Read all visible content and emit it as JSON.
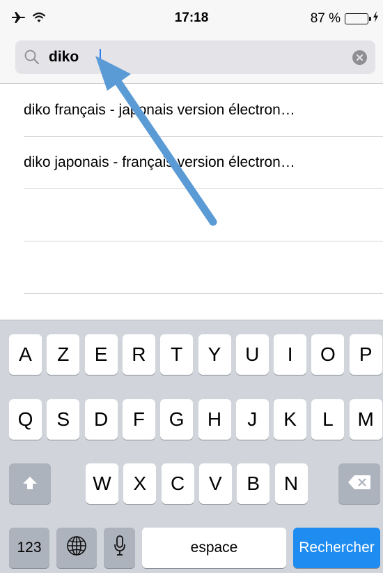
{
  "status": {
    "time": "17:18",
    "battery_text": "87 %",
    "battery_level": 0.87,
    "icons": [
      "airplane-icon",
      "wifi-icon",
      "battery-icon",
      "charging-bolt-icon"
    ]
  },
  "search": {
    "value": "diko",
    "icons": [
      "magnifier-icon",
      "clear-icon"
    ]
  },
  "suggestions": [
    "diko français - japonais version électron…",
    "diko japonais - français version électron…",
    "",
    ""
  ],
  "keyboard": {
    "row1": [
      "A",
      "Z",
      "E",
      "R",
      "T",
      "Y",
      "U",
      "I",
      "O",
      "P"
    ],
    "row2": [
      "Q",
      "S",
      "D",
      "F",
      "G",
      "H",
      "J",
      "K",
      "L",
      "M"
    ],
    "row3": [
      "W",
      "X",
      "C",
      "V",
      "B",
      "N"
    ],
    "numbers_label": "123",
    "space_label": "espace",
    "search_label": "Rechercher",
    "icons": [
      "shift-icon",
      "backspace-icon",
      "globe-icon",
      "microphone-icon"
    ]
  },
  "colors": {
    "accent": "#1e8cf0",
    "arrow": "#5b9bd5",
    "battery": "#4cd964"
  }
}
